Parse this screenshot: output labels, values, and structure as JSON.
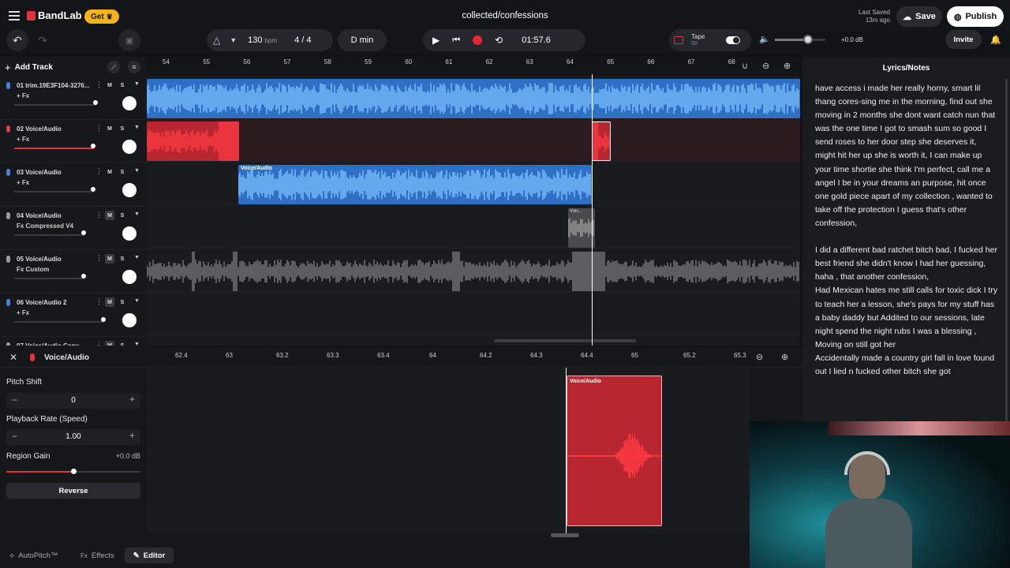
{
  "header": {
    "brand": "BandLab",
    "get_label": "Get",
    "project_title": "collected/confessions",
    "last_saved_label": "Last Saved",
    "last_saved_time": "13m ago",
    "save_label": "Save",
    "publish_label": "Publish"
  },
  "transport": {
    "tempo": "130",
    "tempo_unit": "bpm",
    "time_sig": "4 / 4",
    "key": "D min",
    "time": "01:57.6",
    "tape_label": "Tape",
    "tape_value": "50",
    "volume_db": "+0.0 dB",
    "invite_label": "Invite"
  },
  "tracklist": {
    "add_track_label": "Add Track",
    "tracks": [
      {
        "name": "01  trim.19E3F104-3276...",
        "fx": "+ Fx",
        "color": "#4a7fd6"
      },
      {
        "name": "02  Voice/Audio",
        "fx": "+ Fx",
        "color": "#d6404a"
      },
      {
        "name": "03  Voice/Audio",
        "fx": "+ Fx",
        "color": "#4a7fd6"
      },
      {
        "name": "04  Voice/Audio",
        "fx": "Fx Compressed V4",
        "color": "#9a9a9a"
      },
      {
        "name": "05  Voice/Audio",
        "fx": "Fx Custom",
        "color": "#9a9a9a"
      },
      {
        "name": "06  Voice/Audio 2",
        "fx": "+ Fx",
        "color": "#4a7fd6"
      },
      {
        "name": "07  Voice/Audio Copy",
        "fx": "",
        "color": "#9a9a9a"
      }
    ],
    "mute": "M",
    "solo": "S"
  },
  "timeline": {
    "ticks": [
      "54",
      "55",
      "56",
      "57",
      "58",
      "59",
      "60",
      "61",
      "62",
      "63",
      "64",
      "65",
      "66",
      "67",
      "68"
    ]
  },
  "clips": {
    "track3_label": "Voice/Audio",
    "track4_label": "Voic...",
    "editor_clip_label": "Voice/Audio"
  },
  "lyrics": {
    "title": "Lyrics/Notes",
    "text": "have access i made her really horny, smart lil thang cores-sing me in the morning, find out she moving in 2 months she dont want catch nun that was the one time I got to smash sum so good I send roses to her door step she deserves it, might hit her up she is worth it, I can make up your time shortie she think I'm perfect, call me a angel I be in your dreams an purpose, hit once one gold piece apart of my collection , wanted to take off the protection I guess that's other confession,\n\nI did a different bad ratchet bitch bad, I fucked her best friend she didn't know I had her guessing, haha , that another confession,\nHad Mexican hates me still calls for toxic dick I try to teach her a lesson, she's pays for my stuff has a baby daddy but Addited to our sessions, late night spend the night rubs I was a blessing ,\nMoving on still got her\nAccidentally made a country girl fall in love found out I lied n fucked other bitch she got"
  },
  "editor": {
    "track_label": "Voice/Audio",
    "pitch_shift_label": "Pitch Shift",
    "pitch_shift_value": "0",
    "playback_rate_label": "Playback Rate (Speed)",
    "playback_rate_value": "1.00",
    "region_gain_label": "Region Gain",
    "region_gain_value": "+0.0 dB",
    "region_gain_level": 0.5,
    "reverse_label": "Reverse",
    "ruler_ticks": [
      "62.4",
      "63",
      "63.2",
      "63.3",
      "63.4",
      "64",
      "64.2",
      "64.3",
      "64.4",
      "65",
      "65.2",
      "65.3"
    ]
  },
  "bottom_tabs": {
    "autopitch": "AutoPitch™",
    "effects": "Effects",
    "editor": "Editor"
  },
  "colors": {
    "accent_red": "#e03340",
    "clip_blue": "#3a86e6",
    "get_yellow": "#f2b31d"
  }
}
